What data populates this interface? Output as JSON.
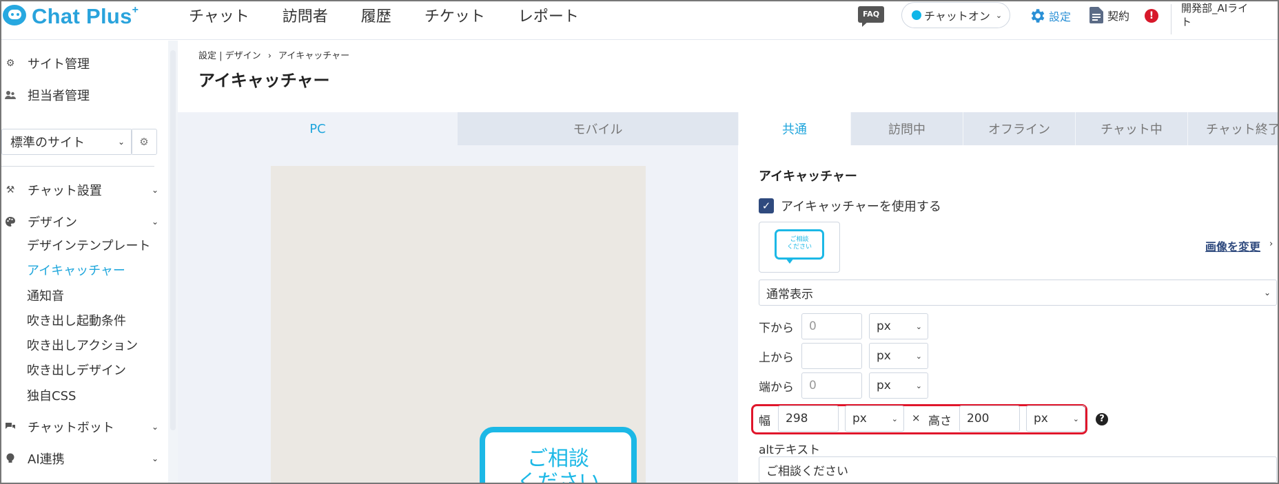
{
  "app": {
    "logo_text": "Chat Plus",
    "logo_sup": "+"
  },
  "topnav": {
    "items": [
      "チャット",
      "訪問者",
      "履歴",
      "チケット",
      "レポート"
    ]
  },
  "header": {
    "faq": "FAQ",
    "chat_status": "チャットオン",
    "settings": "設定",
    "contract": "契約",
    "alert": "!",
    "user_line1": "開発部_AIライ",
    "user_line2": "ト"
  },
  "sidebar": {
    "site_management": "サイト管理",
    "staff_management": "担当者管理",
    "site_select": "標準のサイト",
    "chat_setup": "チャット設置",
    "design": "デザイン",
    "design_items": [
      "デザインテンプレート",
      "アイキャッチャー",
      "通知音",
      "吹き出し起動条件",
      "吹き出しアクション",
      "吹き出しデザイン",
      "独自CSS"
    ],
    "chatbot": "チャットボット",
    "ai_integration": "AI連携"
  },
  "breadcrumb": {
    "part1": "設定",
    "part2": "デザイン",
    "separator": "›",
    "current": "アイキャッチャー"
  },
  "page_title": "アイキャッチャー",
  "preview": {
    "tabs": [
      "PC",
      "モバイル"
    ],
    "bubble_line1": "ご相談",
    "bubble_line2": "ください"
  },
  "settings_tabs": [
    "共通",
    "訪問中",
    "オフライン",
    "チャット中",
    "チャット終了"
  ],
  "settings": {
    "section_title": "アイキャッチャー",
    "use_checkbox_label": "アイキャッチャーを使用する",
    "use_checked": true,
    "thumb_line1": "ご相談",
    "thumb_line2": "ください",
    "change_image": "画像を変更",
    "display_mode": "通常表示",
    "from_bottom_label": "下から",
    "from_bottom_placeholder": "0",
    "from_top_label": "上から",
    "from_top_placeholder": "",
    "from_side_label": "端から",
    "from_side_placeholder": "0",
    "unit": "px",
    "width_label": "幅",
    "width_value": "298",
    "times": "×",
    "height_label": "高さ",
    "height_value": "200",
    "help": "?",
    "alt_label": "altテキスト",
    "alt_value": "ご相談ください"
  },
  "colors": {
    "accent": "#1fa5dc",
    "highlight": "#e0162b",
    "checkbox": "#2f4a7e"
  }
}
